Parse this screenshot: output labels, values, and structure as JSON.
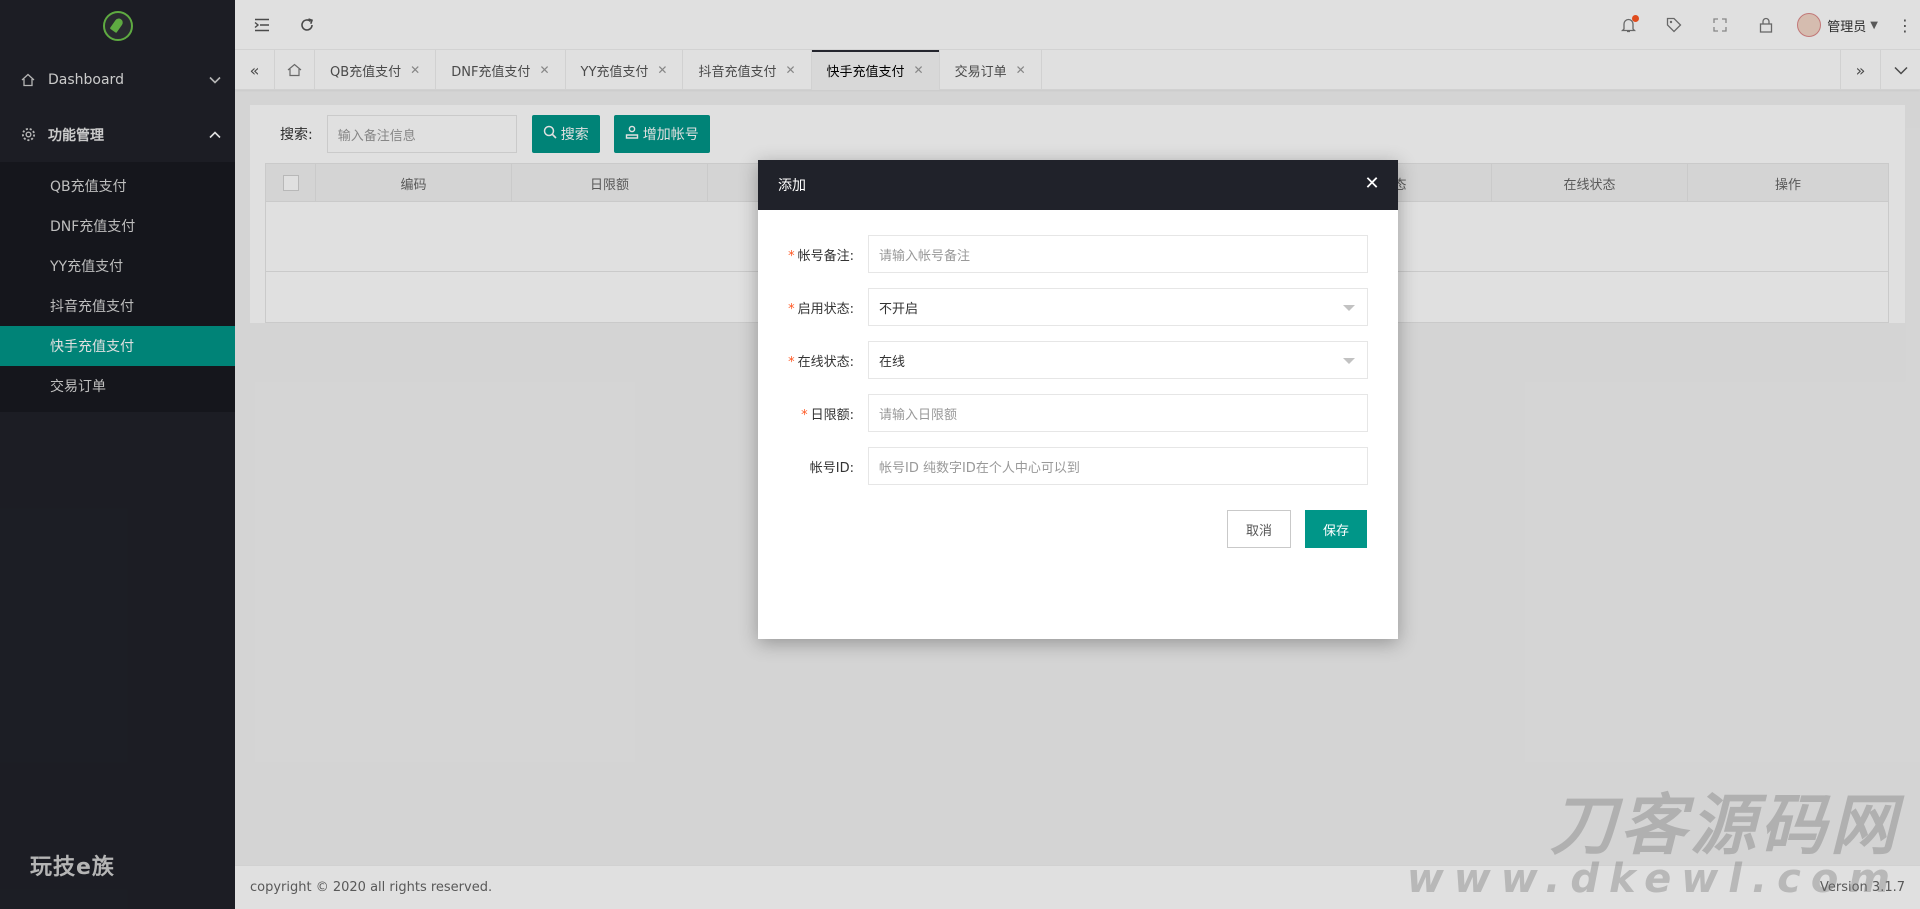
{
  "sidebar": {
    "logo_icon": "rocket-logo-icon",
    "nav": [
      {
        "label": "Dashboard",
        "icon": "home-icon",
        "expanded": false
      },
      {
        "label": "功能管理",
        "icon": "gear-icon",
        "expanded": true
      }
    ],
    "sub_items": [
      {
        "label": "QB充值支付"
      },
      {
        "label": "DNF充值支付"
      },
      {
        "label": "YY充值支付"
      },
      {
        "label": "抖音充值支付"
      },
      {
        "label": "快手充值支付",
        "active": true
      },
      {
        "label": "交易订单"
      }
    ],
    "brand_text": "玩技e族"
  },
  "header": {
    "user_name": "管理员"
  },
  "tabs": [
    {
      "label": "QB充值支付"
    },
    {
      "label": "DNF充值支付"
    },
    {
      "label": "YY充值支付"
    },
    {
      "label": "抖音充值支付"
    },
    {
      "label": "快手充值支付",
      "active": true
    },
    {
      "label": "交易订单"
    }
  ],
  "toolbar": {
    "search_label": "搜索:",
    "search_placeholder": "输入备注信息",
    "search_button": "搜索",
    "add_button": "增加帐号"
  },
  "table": {
    "columns": [
      "编码",
      "日限额",
      "",
      "",
      "",
      "状态",
      "在线状态",
      "操作"
    ]
  },
  "modal": {
    "title": "添加",
    "fields": [
      {
        "label": "帐号备注:",
        "required": true,
        "placeholder": "请输入帐号备注",
        "type": "input"
      },
      {
        "label": "启用状态:",
        "required": true,
        "value": "不开启",
        "type": "select"
      },
      {
        "label": "在线状态:",
        "required": true,
        "value": "在线",
        "type": "select"
      },
      {
        "label": "日限额:",
        "required": true,
        "placeholder": "请输入日限额",
        "type": "input"
      },
      {
        "label": "帐号ID:",
        "required": false,
        "placeholder": "帐号ID 纯数字ID在个人中心可以到",
        "type": "input"
      }
    ],
    "cancel": "取消",
    "save": "保存"
  },
  "footer": {
    "copyright": "copyright © 2020 all rights reserved.",
    "version": "Version 3.1.7"
  },
  "watermark": {
    "text": "刀客源码网",
    "url": "www.dkewl.com"
  },
  "colors": {
    "sidebar_bg": "#20222a",
    "accent": "#009688",
    "danger": "#ff5722"
  }
}
